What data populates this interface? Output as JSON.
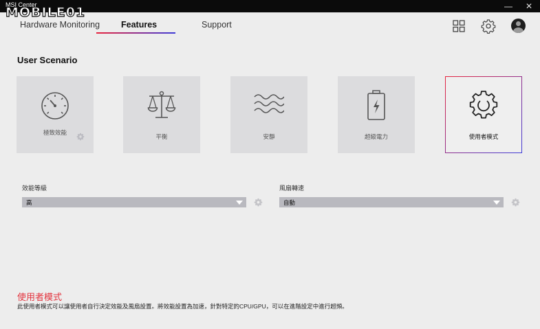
{
  "window": {
    "app_title": "MSI Center",
    "watermark": "MOBILE01",
    "minimize_symbol": "—",
    "close_symbol": "✕"
  },
  "tabs": [
    {
      "label": "Hardware Monitoring",
      "active": false
    },
    {
      "label": "Features",
      "active": true
    },
    {
      "label": "Support",
      "active": false
    }
  ],
  "header_icons": [
    "grid-icon",
    "settings-icon",
    "avatar"
  ],
  "accent": {
    "red": "#e8223c",
    "blue": "#3d3bd8"
  },
  "user_scenario": {
    "title": "User Scenario",
    "cards": [
      {
        "label": "極致效能",
        "icon": "speedometer-icon",
        "has_settings": true,
        "selected": false
      },
      {
        "label": "平衡",
        "icon": "balance-scale-icon",
        "has_settings": false,
        "selected": false
      },
      {
        "label": "安靜",
        "icon": "waves-icon",
        "has_settings": false,
        "selected": false
      },
      {
        "label": "超級電力",
        "icon": "battery-bolt-icon",
        "has_settings": false,
        "selected": false
      },
      {
        "label": "使用者模式",
        "icon": "gear-icon",
        "has_settings": false,
        "selected": true
      }
    ]
  },
  "performance": {
    "label": "效能等級",
    "value": "高"
  },
  "fan": {
    "label": "風扇轉速",
    "value": "自動"
  },
  "description": {
    "title": "使用者模式",
    "text": "此使用者模式可以讓使用者自行決定效能及風扇設置。將效能設置為加速，針對特定的CPU/GPU，可以在進階設定中進行超頻。"
  }
}
